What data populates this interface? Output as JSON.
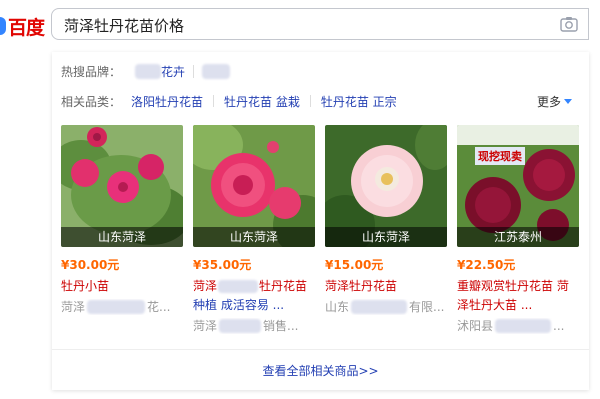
{
  "logo": {
    "text": "百度"
  },
  "search": {
    "query": "菏泽牡丹花苗价格"
  },
  "hot_brands": {
    "label": "热搜品牌：",
    "items": [
      "花卉"
    ]
  },
  "related": {
    "label": "相关品类：",
    "items": [
      "洛阳牡丹花苗",
      "牡丹花苗 盆栽",
      "牡丹花苗 正宗"
    ],
    "more": "更多"
  },
  "products": [
    {
      "location": "山东菏泽",
      "price": "¥30.00元",
      "title": "牡丹小苗",
      "shop": "菏泽",
      "shop_tail": "花..."
    },
    {
      "location": "山东菏泽",
      "price": "¥35.00元",
      "title_a": "菏泽",
      "title_b": "牡丹花苗",
      "title_c": "种植 成活容易 ...",
      "shop": "菏泽",
      "shop_tail": "销售..."
    },
    {
      "location": "山东菏泽",
      "price": "¥15.00元",
      "title": "菏泽牡丹花苗",
      "shop": "山东",
      "shop_tail": "有限..."
    },
    {
      "location": "江苏泰州",
      "price": "¥22.50元",
      "title": "重瓣观赏牡丹花苗 菏泽牡丹大苗 ...",
      "shop": "沭阳县",
      "shop_tail": "..."
    }
  ],
  "img4_caption": "现挖现卖",
  "footer": {
    "link": "查看全部相关商品>>"
  },
  "colors": {
    "accent": "#2440b3",
    "price": "#ff6600",
    "title": "#cc0000",
    "logo_red": "#e10602",
    "logo_blue": "#3385ff"
  }
}
